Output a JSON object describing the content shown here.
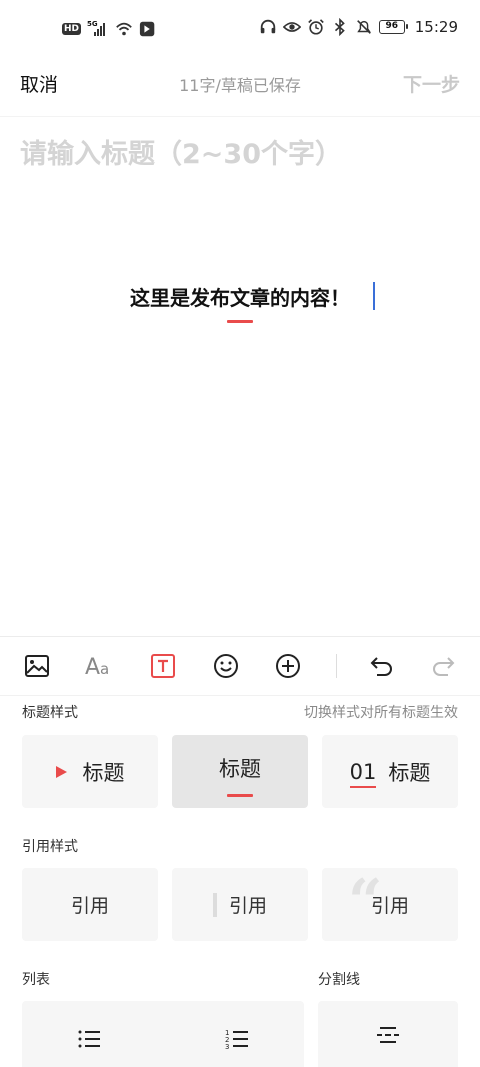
{
  "status_bar": {
    "hd": "HD",
    "network": "5G",
    "battery": "96",
    "time": "15:29"
  },
  "top_bar": {
    "cancel": "取消",
    "draft_status": "11字/草稿已保存",
    "next": "下一步"
  },
  "editor": {
    "title_placeholder": "请输入标题（2~30个字）",
    "body_text": "这里是发布文章的内容！"
  },
  "toolbar": {
    "icons": [
      "image-icon",
      "font-icon",
      "text-style-icon",
      "emoji-icon",
      "add-icon",
      "undo-icon",
      "redo-icon"
    ],
    "accent": "#e94b4b"
  },
  "panel": {
    "heading_style": {
      "label": "标题样式",
      "hint": "切换样式对所有标题生效",
      "options": [
        {
          "text": "标题"
        },
        {
          "text": "标题"
        },
        {
          "number": "01",
          "text": "标题"
        }
      ]
    },
    "quote_style": {
      "label": "引用样式",
      "options": [
        "引用",
        "引用",
        "引用"
      ]
    },
    "list": {
      "label": "列表"
    },
    "divider": {
      "label": "分割线"
    }
  }
}
